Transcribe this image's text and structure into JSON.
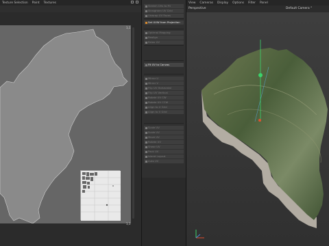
{
  "uv_editor": {
    "menu": [
      "Texture Selection",
      "Paint",
      "Textures"
    ],
    "corner_top": "1,1",
    "corner_bottom": "1,1"
  },
  "tools": {
    "items": [
      {
        "label": "Stretch UVs to Fit",
        "state": "dim"
      },
      {
        "label": "Straighten UV Grid",
        "state": "dim"
      },
      {
        "label": "Unwrap UV Faces",
        "state": "dim"
      },
      {
        "label": "Set UVW from Projection",
        "state": "hl"
      },
      {
        "label": "Optimal Mapping",
        "state": "dim"
      },
      {
        "label": "Realign",
        "state": "dim"
      },
      {
        "label": "Relax UV",
        "state": "dim"
      },
      {
        "label": "Fit UV to Canvas",
        "state": "active"
      },
      {
        "label": "Mirror U",
        "state": "dim"
      },
      {
        "label": "Mirror V",
        "state": "dim"
      },
      {
        "label": "Flip UV Horizontal",
        "state": "dim"
      },
      {
        "label": "Flip UV Vertical",
        "state": "dim"
      },
      {
        "label": "Rotate UV CW",
        "state": "dim"
      },
      {
        "label": "Rotate UV CCW",
        "state": "dim"
      },
      {
        "label": "Align to U Grid",
        "state": "dim"
      },
      {
        "label": "Align to V Grid",
        "state": "dim"
      },
      {
        "label": "Scale UV",
        "state": "dim"
      },
      {
        "label": "Scale UV",
        "state": "dim"
      },
      {
        "label": "Move UV",
        "state": "dim"
      },
      {
        "label": "Rotate UV",
        "state": "dim"
      },
      {
        "label": "Shear UV",
        "state": "dim"
      },
      {
        "label": "Pack UV",
        "state": "dim"
      },
      {
        "label": "Island Layout",
        "state": "dim"
      },
      {
        "label": "Auto UV",
        "state": "dim"
      }
    ]
  },
  "viewport": {
    "menu": [
      "View",
      "Cameras",
      "Display",
      "Options",
      "Filter",
      "Panel"
    ],
    "title": "Perspective",
    "camera": "Default Camera °"
  },
  "colors": {
    "accent_orange": "#d98a2c",
    "uv_shape": "#8a8a8a",
    "terrain_dark": "#3d5233",
    "terrain_light": "#7d8a5e"
  }
}
